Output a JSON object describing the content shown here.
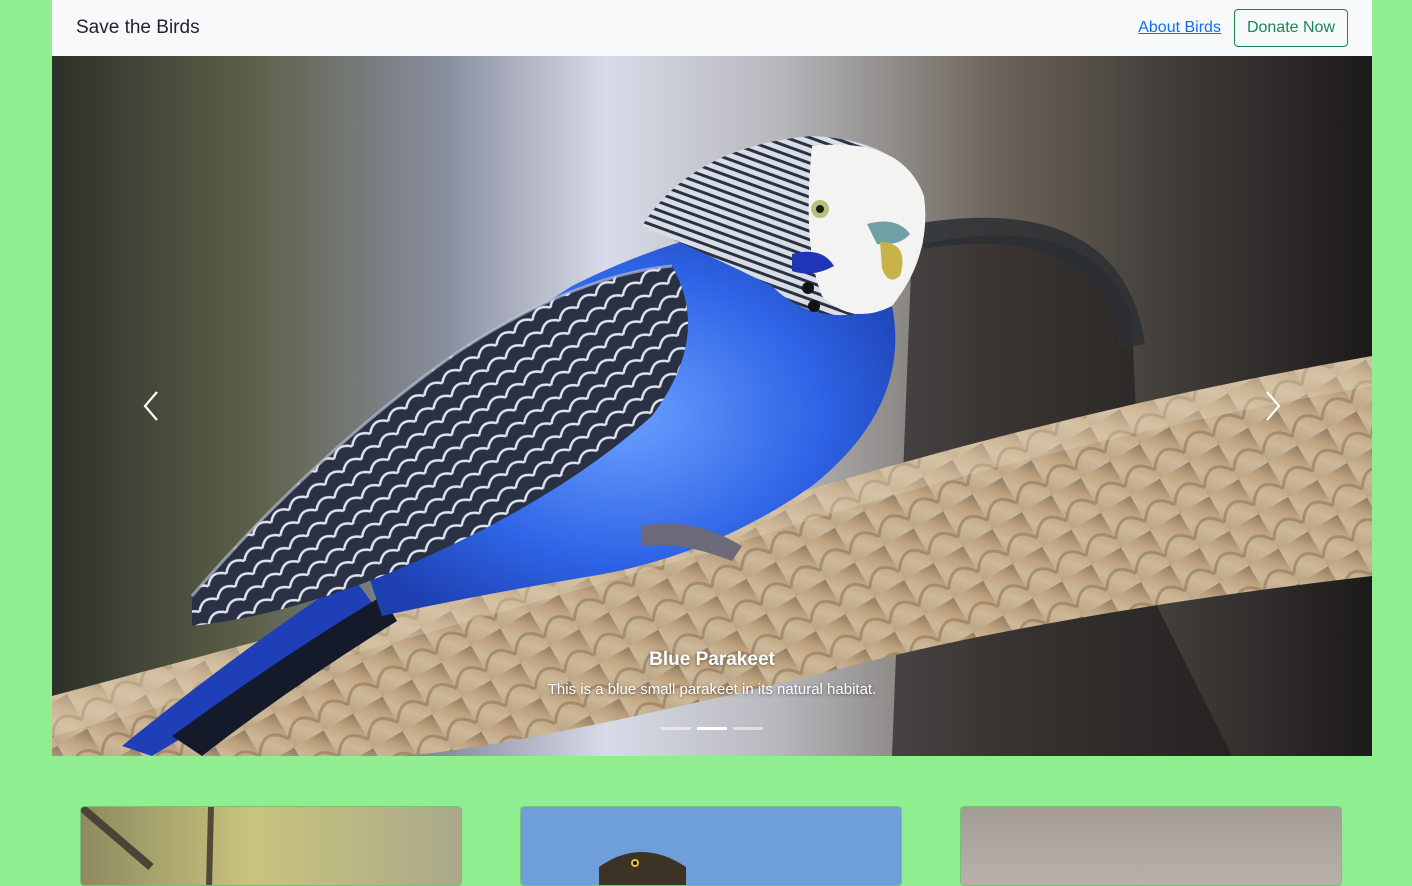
{
  "navbar": {
    "brand": "Save the Birds",
    "about_link": "About Birds",
    "donate_button": "Donate Now"
  },
  "carousel": {
    "caption_title": "Blue Parakeet",
    "caption_text": "This is a blue small parakeet in its natural habitat.",
    "active_slide": 2,
    "slide_count": 3,
    "prev_icon": "chevron-left-icon",
    "next_icon": "chevron-right-icon"
  },
  "cards": [
    {
      "image": "bird-on-branch-photo"
    },
    {
      "image": "hawk-photo"
    },
    {
      "image": "bird-photo"
    }
  ],
  "colors": {
    "background": "#90ee90",
    "navbar_bg": "#f8f9fa",
    "link": "#0d6efd",
    "donate_outline": "#198754"
  }
}
